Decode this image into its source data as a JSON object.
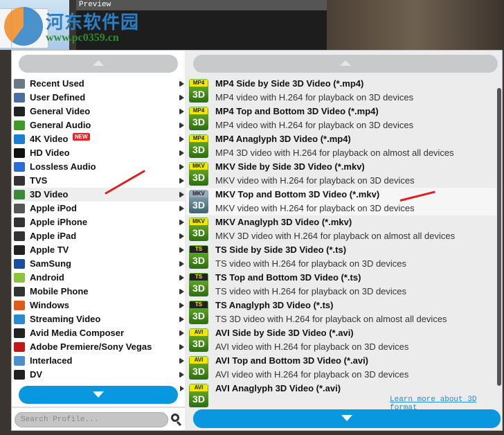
{
  "window": {
    "preview_label": "Preview"
  },
  "watermark": {
    "name": "河东软件园",
    "url": "www.pc0359.cn"
  },
  "left_panel": {
    "items": [
      {
        "label": "Recent Used",
        "icon": "recent-icon",
        "color": "#6a7a86"
      },
      {
        "label": "User Defined",
        "icon": "user-icon",
        "color": "#4a6fa0"
      },
      {
        "label": "General Video",
        "icon": "film-icon",
        "color": "#222222"
      },
      {
        "label": "General Audio",
        "icon": "audio-icon",
        "color": "#3f9a2a"
      },
      {
        "label": "4K Video",
        "icon": "4k-icon",
        "color": "#1a7fd0",
        "badge": "NEW"
      },
      {
        "label": "HD Video",
        "icon": "hd-icon",
        "color": "#111111"
      },
      {
        "label": "Lossless Audio",
        "icon": "music-note-icon",
        "color": "#2a6fd0"
      },
      {
        "label": "TVS",
        "icon": "tv-icon",
        "color": "#333333"
      },
      {
        "label": "3D Video",
        "icon": "3d-icon",
        "color": "#3a8a3a",
        "selected": true
      },
      {
        "label": "Apple iPod",
        "icon": "ipod-icon",
        "color": "#555555"
      },
      {
        "label": "Apple iPhone",
        "icon": "iphone-icon",
        "color": "#333333"
      },
      {
        "label": "Apple iPad",
        "icon": "ipad-icon",
        "color": "#333333"
      },
      {
        "label": "Apple TV",
        "icon": "apple-tv-icon",
        "color": "#222222"
      },
      {
        "label": "SamSung",
        "icon": "samsung-icon",
        "color": "#1a4fa0"
      },
      {
        "label": "Android",
        "icon": "android-icon",
        "color": "#8ac43a"
      },
      {
        "label": "Mobile Phone",
        "icon": "phone-icon",
        "color": "#333333"
      },
      {
        "label": "Windows",
        "icon": "windows-icon",
        "color": "#e05a1a"
      },
      {
        "label": "Streaming Video",
        "icon": "streaming-icon",
        "color": "#2a8ad0"
      },
      {
        "label": "Avid Media Composer",
        "icon": "avid-icon",
        "color": "#222222"
      },
      {
        "label": "Adobe Premiere/Sony Vegas",
        "icon": "adobe-icon",
        "color": "#c01818"
      },
      {
        "label": "Interlaced",
        "icon": "interlaced-icon",
        "color": "#4a90d0"
      },
      {
        "label": "DV",
        "icon": "dv-camera-icon",
        "color": "#222222"
      }
    ],
    "search_placeholder": "Search Profile..."
  },
  "right_panel": {
    "formats": [
      {
        "badge": "MP4",
        "title": "MP4 Side by Side 3D Video (*.mp4)",
        "desc": "MP4 video with H.264 for playback on 3D devices"
      },
      {
        "badge": "MP4",
        "title": "MP4 Top and Bottom 3D Video (*.mp4)",
        "desc": "MP4 video with H.264 for playback on 3D devices"
      },
      {
        "badge": "MP4",
        "title": "MP4 Anaglyph 3D Video (*.mp4)",
        "desc": "MP4 3D video with H.264 for playback on almost all devices"
      },
      {
        "badge": "MKV",
        "title": "MKV Side by Side 3D Video (*.mkv)",
        "desc": "MKV video with H.264 for playback on 3D devices"
      },
      {
        "badge": "MKV",
        "title": "MKV Top and Bottom 3D Video (*.mkv)",
        "desc": "MKV video with H.264 for playback on 3D devices",
        "selected": true
      },
      {
        "badge": "MKV",
        "title": "MKV Anaglyph 3D Video (*.mkv)",
        "desc": "MKV 3D video with H.264 for playback on almost all devices"
      },
      {
        "badge": "TS",
        "title": "TS Side by Side 3D Video (*.ts)",
        "desc": "TS video with H.264 for playback on 3D devices"
      },
      {
        "badge": "TS",
        "title": "TS Top and Bottom 3D Video (*.ts)",
        "desc": "TS video with H.264 for playback on 3D devices"
      },
      {
        "badge": "TS",
        "title": "TS Anaglyph 3D Video (*.ts)",
        "desc": "TS 3D video with H.264 for playback on almost all devices"
      },
      {
        "badge": "AVI",
        "title": "AVI Side by Side 3D Video (*.avi)",
        "desc": "AVI video with H.264 for playback on 3D devices"
      },
      {
        "badge": "AVI",
        "title": "AVI Top and Bottom 3D Video (*.avi)",
        "desc": "AVI video with H.264 for playback on 3D devices"
      },
      {
        "badge": "AVI",
        "title": "AVI Anaglyph 3D Video (*.avi)",
        "desc": ""
      }
    ],
    "icon_3d_label": "3D",
    "learn_more": "Learn more about 3D format"
  },
  "colors": {
    "accent": "#0998e0",
    "annotation_arrow": "#e02020"
  }
}
